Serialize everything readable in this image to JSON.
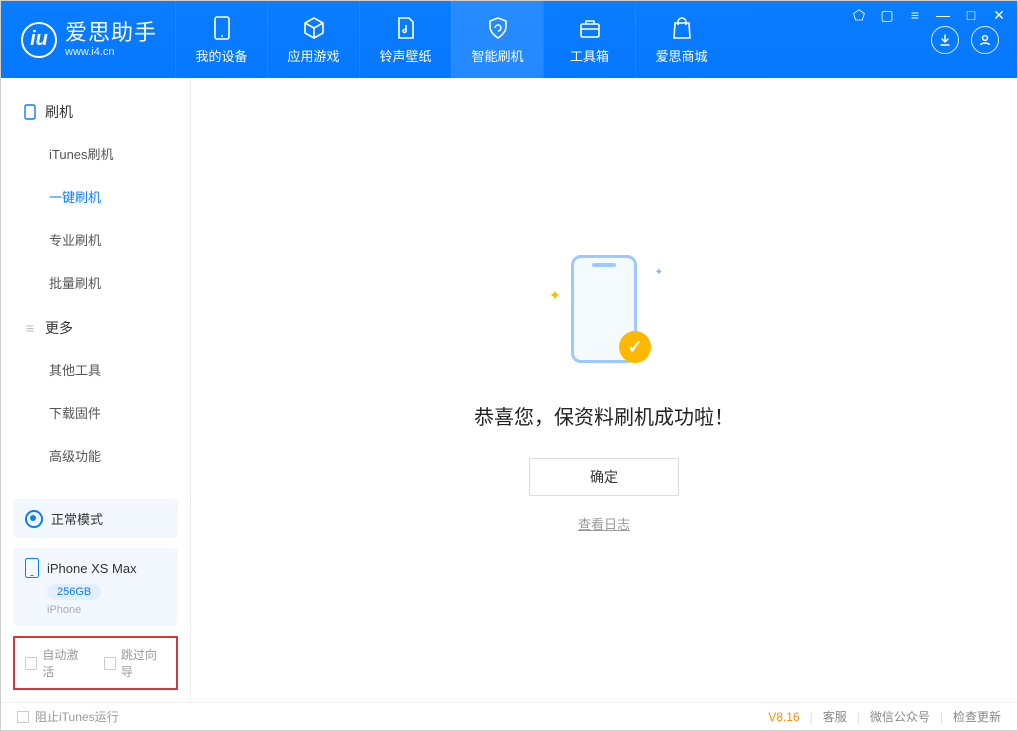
{
  "app": {
    "name_cn": "爱思助手",
    "name_en": "www.i4.cn"
  },
  "nav": {
    "items": [
      {
        "label": "我的设备"
      },
      {
        "label": "应用游戏"
      },
      {
        "label": "铃声壁纸"
      },
      {
        "label": "智能刷机"
      },
      {
        "label": "工具箱"
      },
      {
        "label": "爱思商城"
      }
    ]
  },
  "sidebar": {
    "sections": [
      {
        "title": "刷机",
        "items": [
          {
            "label": "iTunes刷机"
          },
          {
            "label": "一键刷机"
          },
          {
            "label": "专业刷机"
          },
          {
            "label": "批量刷机"
          }
        ]
      },
      {
        "title": "更多",
        "items": [
          {
            "label": "其他工具"
          },
          {
            "label": "下载固件"
          },
          {
            "label": "高级功能"
          }
        ]
      }
    ],
    "mode": "正常模式",
    "device": {
      "name": "iPhone XS Max",
      "storage": "256GB",
      "type": "iPhone"
    },
    "options": {
      "auto_activate": "自动激活",
      "skip_guide": "跳过向导"
    }
  },
  "main": {
    "message": "恭喜您，保资料刷机成功啦！",
    "ok": "确定",
    "view_log": "查看日志"
  },
  "footer": {
    "block_itunes": "阻止iTunes运行",
    "version": "V8.16",
    "links": {
      "service": "客服",
      "wechat": "微信公众号",
      "update": "检查更新"
    }
  }
}
